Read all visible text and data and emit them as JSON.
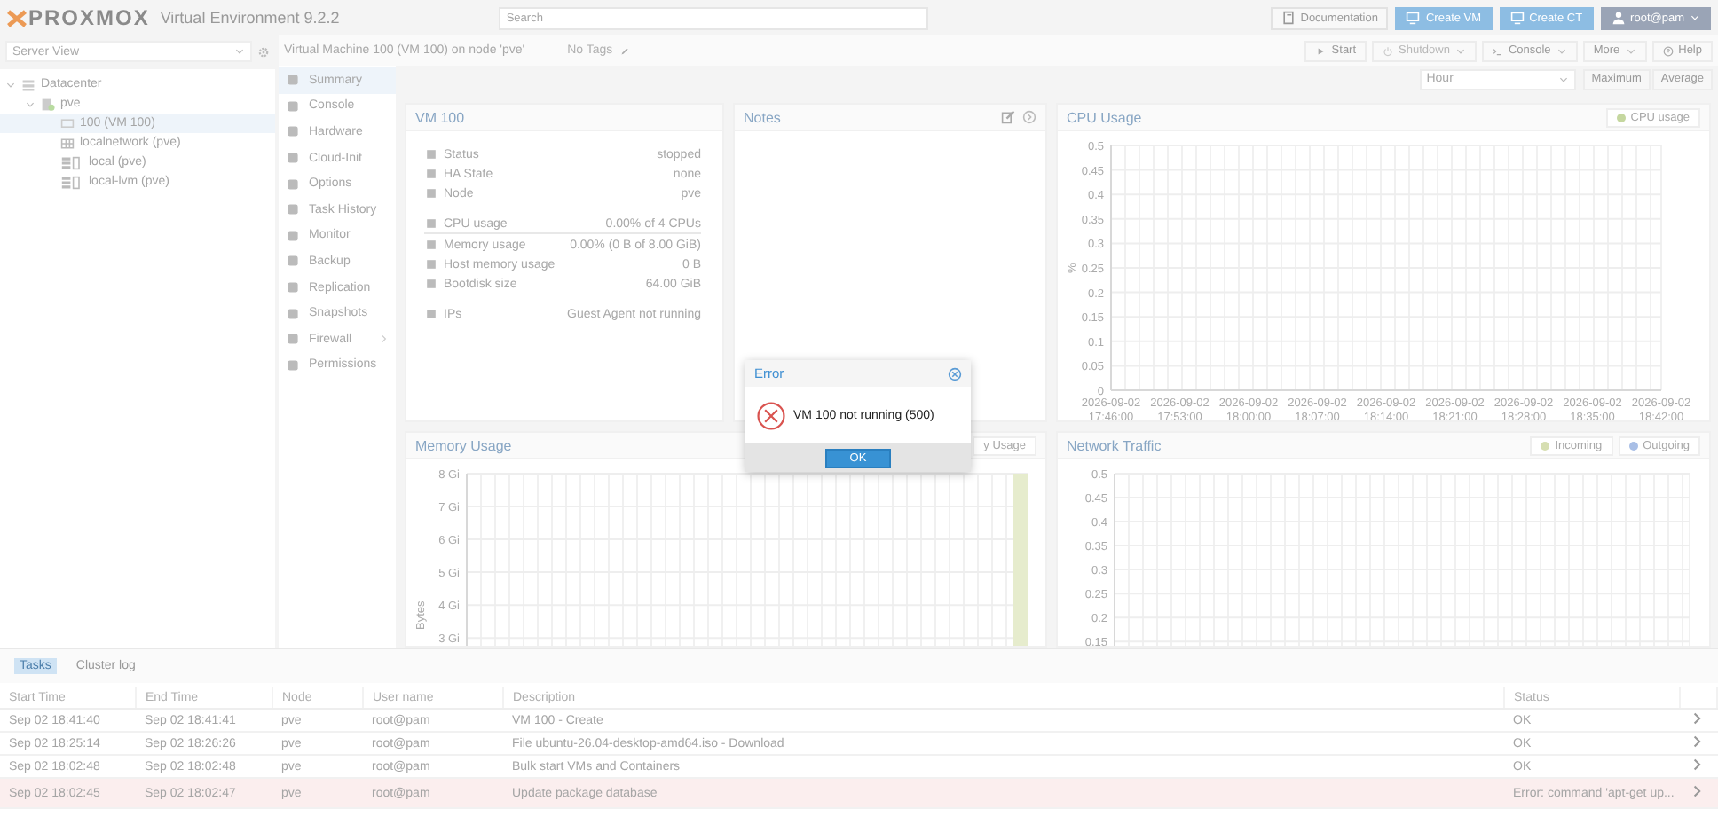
{
  "header": {
    "logo": "PROXMOX",
    "product": "Virtual Environment 9.2.2",
    "search": {
      "placeholder": "Search"
    },
    "buttons": [
      {
        "label": "Documentation",
        "kind": "plain"
      },
      {
        "label": "Create VM",
        "kind": "primary"
      },
      {
        "label": "Create CT",
        "kind": "primary"
      },
      {
        "label": "root@pam",
        "kind": "user"
      }
    ]
  },
  "sidebar": {
    "view": "Server View",
    "tree": [
      {
        "label": "Datacenter",
        "kind": "datacenter",
        "expanded": true,
        "selected": false,
        "children": [
          {
            "label": "pve",
            "kind": "node",
            "expanded": true,
            "selected": false,
            "children": [
              {
                "label": "100 (VM 100)",
                "kind": "vm",
                "selected": true
              },
              {
                "label": "localnetwork (pve)",
                "kind": "network",
                "selected": false
              },
              {
                "label": "local (pve)",
                "kind": "storage",
                "selected": false
              },
              {
                "label": "local-lvm (pve)",
                "kind": "storage",
                "selected": false
              }
            ]
          }
        ]
      }
    ]
  },
  "toolbar": {
    "title": "Virtual Machine 100 (VM 100) on node 'pve'",
    "tags": "No Tags",
    "buttons": [
      {
        "label": "Start",
        "disabled": false,
        "menu": false
      },
      {
        "label": "Shutdown",
        "disabled": true,
        "menu": true
      },
      {
        "label": "Console",
        "disabled": false,
        "menu": true
      },
      {
        "label": "More",
        "disabled": false,
        "menu": true
      },
      {
        "label": "Help",
        "disabled": false,
        "menu": false
      }
    ]
  },
  "nav": [
    {
      "label": "Summary",
      "selected": true,
      "submenu": false
    },
    {
      "label": "Console",
      "selected": false,
      "submenu": false
    },
    {
      "label": "Hardware",
      "selected": false,
      "submenu": false
    },
    {
      "label": "Cloud-Init",
      "selected": false,
      "submenu": false
    },
    {
      "label": "Options",
      "selected": false,
      "submenu": false
    },
    {
      "label": "Task History",
      "selected": false,
      "submenu": false
    },
    {
      "label": "Monitor",
      "selected": false,
      "submenu": false
    },
    {
      "label": "Backup",
      "selected": false,
      "submenu": false
    },
    {
      "label": "Replication",
      "selected": false,
      "submenu": false
    },
    {
      "label": "Snapshots",
      "selected": false,
      "submenu": false
    },
    {
      "label": "Firewall",
      "selected": false,
      "submenu": true
    },
    {
      "label": "Permissions",
      "selected": false,
      "submenu": false
    }
  ],
  "timeframe": {
    "value": "Hour",
    "buttons": [
      "Maximum",
      "Average"
    ]
  },
  "summary": {
    "title": "VM 100",
    "groups": [
      [
        {
          "label": "Status",
          "value": "stopped"
        },
        {
          "label": "HA State",
          "value": "none"
        },
        {
          "label": "Node",
          "value": "pve"
        }
      ],
      [
        {
          "label": "CPU usage",
          "value": "0.00% of 4 CPUs",
          "level": 0
        },
        {
          "label": "Memory usage",
          "value": "0.00% (0 B of 8.00 GiB)"
        },
        {
          "label": "Host memory usage",
          "value": "0 B"
        },
        {
          "label": "Bootdisk size",
          "value": "64.00 GiB"
        }
      ],
      [
        {
          "label": "IPs",
          "value": "Guest Agent not running"
        }
      ]
    ]
  },
  "notes": {
    "title": "Notes"
  },
  "cpu_panel": {
    "title": "CPU Usage",
    "chart_data": {
      "type": "line",
      "ylabel": "%",
      "grid": true,
      "categories": [
        "2026-09-02 17:46:00",
        "2026-09-02 17:53:00",
        "2026-09-02 18:00:00",
        "2026-09-02 18:07:00",
        "2026-09-02 18:14:00",
        "2026-09-02 18:21:00",
        "2026-09-02 18:28:00",
        "2026-09-02 18:35:00",
        "2026-09-02 18:42:00"
      ],
      "series": [
        {
          "name": "CPU usage",
          "color": "#c5d79f",
          "values": [
            null,
            null,
            null,
            null,
            null,
            null,
            null,
            null,
            null
          ]
        }
      ],
      "ylim": [
        0,
        0.5
      ],
      "yticks": [
        0,
        0.05,
        0.1,
        0.15,
        0.2,
        0.25,
        0.3,
        0.35,
        0.4,
        0.45,
        0.5
      ]
    }
  },
  "memory_panel": {
    "title": "Memory Usage",
    "chart_data": {
      "type": "area",
      "ylabel": "Bytes",
      "grid": true,
      "series": [
        {
          "name": "y Usage",
          "color": "#e6eccd",
          "values": [
            null,
            null,
            null,
            null,
            null,
            null,
            null,
            null,
            null,
            null,
            null,
            null,
            null,
            null,
            null,
            null,
            null,
            null,
            null,
            null,
            null,
            null,
            null,
            null,
            null,
            null,
            null,
            null,
            null,
            null,
            null,
            null,
            null,
            null,
            null,
            null,
            null,
            null,
            null,
            null,
            null,
            null,
            null,
            null,
            null,
            null,
            null,
            null,
            null,
            null,
            null,
            null,
            null,
            null,
            null,
            null,
            null,
            null,
            null,
            null,
            null,
            null,
            null,
            null,
            null,
            null,
            null,
            null,
            null,
            null,
            null,
            null,
            null,
            8,
            8
          ]
        }
      ],
      "ylim": [
        2.6,
        8
      ],
      "yticks": [
        {
          "value": 3,
          "label": "3 Gi"
        },
        {
          "value": 4,
          "label": "4 Gi"
        },
        {
          "value": 5,
          "label": "5 Gi"
        },
        {
          "value": 6,
          "label": "6 Gi"
        },
        {
          "value": 7,
          "label": "7 Gi"
        },
        {
          "value": 8,
          "label": "8 Gi"
        }
      ]
    }
  },
  "network_panel": {
    "title": "Network Traffic",
    "chart_data": {
      "type": "line",
      "grid": true,
      "series": [
        {
          "name": "Incoming",
          "color": "#d6deb1",
          "values": [
            null,
            null,
            null,
            null,
            null,
            null,
            null,
            null,
            null
          ]
        },
        {
          "name": "Outgoing",
          "color": "#a9bfe6",
          "values": [
            null,
            null,
            null,
            null,
            null,
            null,
            null,
            null,
            null
          ]
        }
      ],
      "ylim": [
        0.13,
        0.5
      ],
      "yticks": [
        0.15,
        0.2,
        0.25,
        0.3,
        0.35,
        0.4,
        0.45,
        0.5
      ]
    }
  },
  "dialog": {
    "title": "Error",
    "message": "VM 100 not running (500)",
    "button": "OK"
  },
  "tasks": {
    "tabs": [
      {
        "label": "Tasks",
        "selected": true
      },
      {
        "label": "Cluster log",
        "selected": false
      }
    ],
    "columns": [
      "Start Time",
      "End Time",
      "Node",
      "User name",
      "Description",
      "Status"
    ],
    "rows": [
      {
        "cells": [
          "Sep 02 18:41:40",
          "Sep 02 18:41:41",
          "pve",
          "root@pam",
          "VM 100 - Create",
          "OK"
        ],
        "error": false
      },
      {
        "cells": [
          "Sep 02 18:25:14",
          "Sep 02 18:26:26",
          "pve",
          "root@pam",
          "File ubuntu-26.04-desktop-amd64.iso - Download",
          "OK"
        ],
        "error": false
      },
      {
        "cells": [
          "Sep 02 18:02:48",
          "Sep 02 18:02:48",
          "pve",
          "root@pam",
          "Bulk start VMs and Containers",
          "OK"
        ],
        "error": false
      },
      {
        "cells": [
          "Sep 02 18:02:45",
          "Sep 02 18:02:47",
          "pve",
          "root@pam",
          "Update package database",
          "Error: command 'apt-get up..."
        ],
        "error": true
      }
    ]
  }
}
